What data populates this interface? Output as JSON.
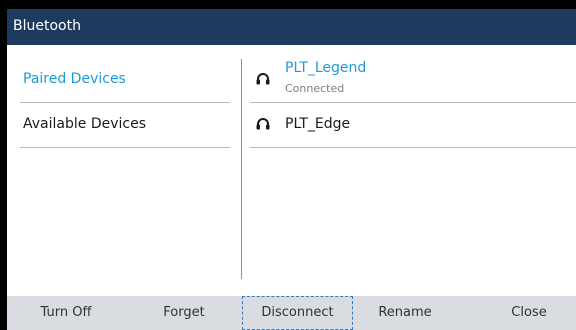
{
  "title": "Bluetooth",
  "tabs": [
    {
      "label": "Paired Devices",
      "selected": true
    },
    {
      "label": "Available Devices",
      "selected": false
    }
  ],
  "devices": [
    {
      "name": "PLT_Legend",
      "status": "Connected",
      "icon": "headset-icon"
    },
    {
      "name": "PLT_Edge",
      "status": "",
      "icon": "headset-icon"
    }
  ],
  "softkeys": {
    "turn_off": "Turn Off",
    "forget": "Forget",
    "disconnect": "Disconnect",
    "rename": "Rename",
    "close": "Close"
  },
  "colors": {
    "titlebar": "#1d3b5f",
    "accent": "#1e9bd7",
    "softkey_bar": "#d9dde2"
  }
}
